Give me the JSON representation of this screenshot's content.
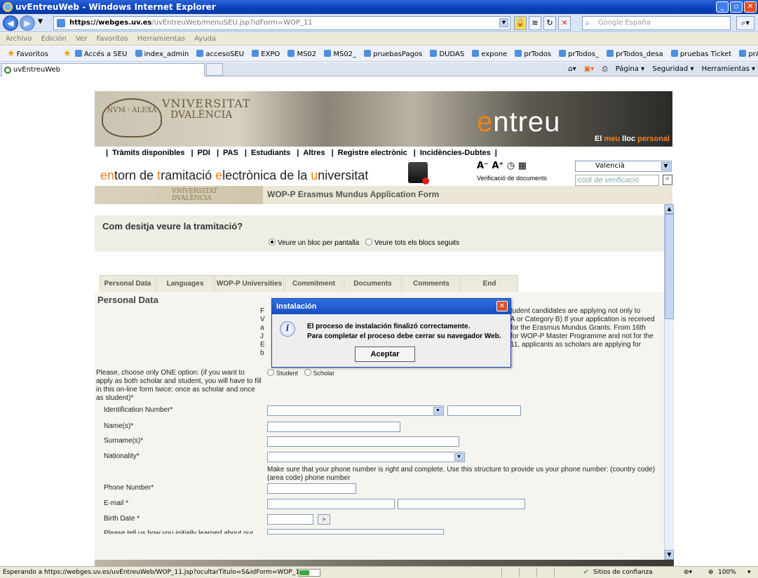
{
  "window": {
    "title": "uvEntreuWeb - Windows Internet Explorer"
  },
  "address": {
    "host": "https://webges.uv.es",
    "path": "/uvEntreuWeb/menuSEU.jsp?idForm=WOP_11",
    "search_placeholder": "Google España"
  },
  "menu": [
    "Archivo",
    "Edición",
    "Ver",
    "Favoritos",
    "Herramientas",
    "Ayuda"
  ],
  "favorites": {
    "label": "Favoritos",
    "items": [
      "Accés a SEU",
      "index_admin",
      "accesoSEU",
      "EXPO",
      "MS02",
      "MS02_",
      "pruebasPagos",
      "DUDAS",
      "expone",
      "prTodos",
      "prTodos_",
      "prTodos_desa",
      "pruebas Ticket",
      "prAdjunto"
    ]
  },
  "tab": {
    "title": "uvEntreuWeb"
  },
  "tools": [
    "Página ▾",
    "Seguridad ▾",
    "Herramientas ▾"
  ],
  "site": {
    "uni_line1": "VNIVERSITAT",
    "uni_line2": "DVALÈNCIA",
    "seal_text": "NVM · ALEXA",
    "entreu_e": "e",
    "entreu_rest": "ntreu",
    "tagline_a": "El ",
    "tagline_b": "meu",
    "tagline_c": " lloc ",
    "tagline_d": "personal",
    "nav": [
      "Tràmits disponibles",
      "PDI",
      "PAS",
      "Estudiants",
      "Altres",
      "Registre electrònic",
      "Incidències-Dubtes"
    ],
    "entorn": {
      "a": "en",
      "b": "torn de ",
      "c": "t",
      "d": "ramitació ",
      "e": "e",
      "f": "lectrònica de la ",
      "g": "u",
      "h": "niversitat"
    },
    "access_icons": "A⁻ A⁺ ◷ ▦",
    "verif_label": "Verificació de documents",
    "language": "Valencià",
    "code_placeholder": "codi de verificació",
    "crest_line1": "VNIVERSITAT",
    "crest_line2": "DVALÈNCIA",
    "form_title": "WOP-P Erasmus Mundus Application Form"
  },
  "form": {
    "mode_question": "Com desitja veure la tramitació?",
    "mode_opt1": "Veure un bloc per pantalla",
    "mode_opt2": "Veure tots els blocs seguits",
    "tabs": [
      "Personal Data",
      "Languages",
      "WOP-P Universities",
      "Commitment",
      "Documents",
      "Comments",
      "End"
    ],
    "section_title": "Personal Data",
    "bg_lines": [
      "F",
      "V",
      "a",
      "J",
      "E",
      "b",
      "tudent candidates are applying not only to",
      "A or Category B) If your application is received",
      "for the Erasmus Mundus Grants. From 16th",
      "for WOP-P Master Programme and not for the",
      "11, applicants as scholars are applying for"
    ],
    "choose_label": "Please, choose only ONE option: (if you want to apply as both scholar and student, you will have to fill in this on-line form twice: once as scholar and once as student)*",
    "student": "Student",
    "scholar": "Scholar",
    "id_label": "Identification Number*",
    "name_label": "Name(s)*",
    "surname_label": "Surname(s)*",
    "nationality_label": "Nationality*",
    "phone_hint": "Make sure that your phone number is right and complete. Use this structure to provide us your phone number: (country code) (area code) phone number",
    "phone_label": "Phone Number*",
    "email_label": "E-mail *",
    "birth_label": "Birth Date *",
    "birth_btn": ">",
    "cut_label": "Please tell us how you initially learned about our"
  },
  "dialog": {
    "title": "Instalación",
    "line1": "El proceso de instalación finalizó correctamente.",
    "line2": "Para completar el proceso debe cerrar su navegador Web.",
    "button": "Aceptar"
  },
  "status": {
    "text": "Esperando a https://webges.uv.es/uvEntreuWeb/WOP_11.jsp?ocultarTitulo=S&idForm=WOP_11...",
    "zone": "Sitios de confianza",
    "zoom": "100%"
  }
}
